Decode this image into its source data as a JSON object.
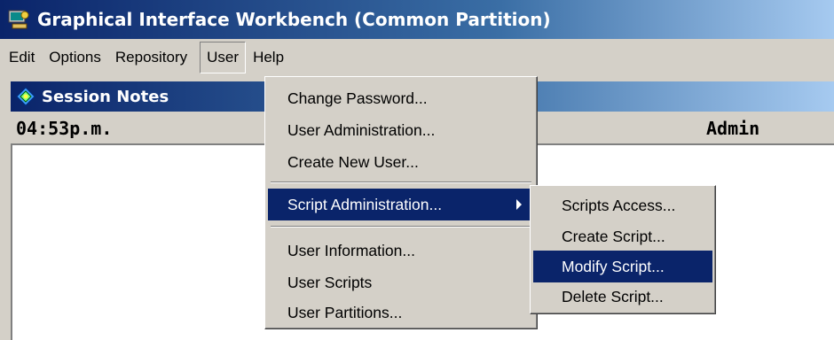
{
  "window": {
    "title": "Graphical Interface Workbench (Common Partition)",
    "icon": "workbench-app-icon"
  },
  "menubar": {
    "items": [
      {
        "label": "Edit"
      },
      {
        "label": "Options"
      },
      {
        "label": "Repository"
      },
      {
        "label": "User",
        "active": true
      },
      {
        "label": "Help"
      }
    ]
  },
  "child_window": {
    "title": "Session Notes",
    "icon": "notes-icon",
    "time": "04:53p.m.",
    "user": "Admin"
  },
  "user_menu": {
    "group1": [
      {
        "label": "Change Password..."
      },
      {
        "label": "User Administration..."
      },
      {
        "label": "Create New User..."
      }
    ],
    "group2": [
      {
        "label": "Script Administration...",
        "submenu": true,
        "highlighted": true
      }
    ],
    "group3": [
      {
        "label": "User Information..."
      },
      {
        "label": "User Scripts"
      },
      {
        "label": "User Partitions..."
      }
    ]
  },
  "script_submenu": {
    "items": [
      {
        "label": "Scripts Access..."
      },
      {
        "label": "Create Script..."
      },
      {
        "label": "Modify Script...",
        "highlighted": true
      },
      {
        "label": "Delete Script..."
      }
    ]
  },
  "colors": {
    "titlebar_active": "#0a246a",
    "highlight": "#0a246a",
    "face": "#d4d0c8"
  }
}
